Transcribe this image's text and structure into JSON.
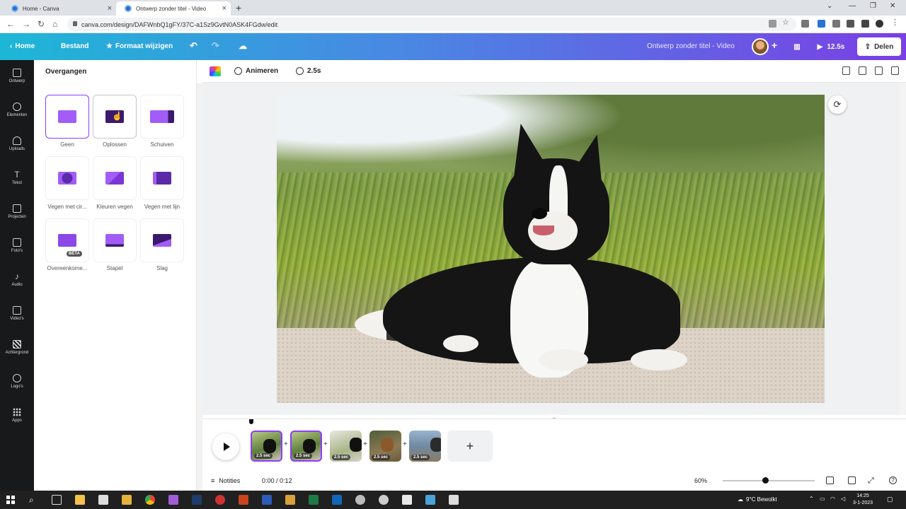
{
  "browser": {
    "tabs": [
      {
        "title": "Home - Canva",
        "active": false
      },
      {
        "title": "Ontwerp zonder titel - Video",
        "active": true
      }
    ],
    "new_tab_icon": "plus-icon",
    "url": "canva.com/design/DAFWnbQ1gFY/37C-a1Sz9GvtN0ASK4FGdw/edit"
  },
  "header": {
    "back_label": "Home",
    "file_label": "Bestand",
    "resize_label": "Formaat wijzigen",
    "doc_title": "Ontwerp zonder titel - Video",
    "play_duration": "12.5s",
    "share_label": "Delen",
    "colors": {
      "gradient_start": "#1db7d6",
      "gradient_end": "#7a3fe4",
      "accent": "#8b3dff"
    }
  },
  "rail": {
    "items": [
      {
        "label": "Ontwerp",
        "icon": "layout-icon"
      },
      {
        "label": "Elementen",
        "icon": "shapes-icon"
      },
      {
        "label": "Uploads",
        "icon": "cloud-upload-icon"
      },
      {
        "label": "Tekst",
        "icon": "text-icon"
      },
      {
        "label": "Projecten",
        "icon": "folder-icon"
      },
      {
        "label": "Foto's",
        "icon": "image-icon"
      },
      {
        "label": "Audio",
        "icon": "music-icon"
      },
      {
        "label": "Video's",
        "icon": "video-icon"
      },
      {
        "label": "Achtergrond",
        "icon": "pattern-icon"
      },
      {
        "label": "Logo's",
        "icon": "logo-icon"
      },
      {
        "label": "Apps",
        "icon": "apps-grid-icon"
      }
    ]
  },
  "panel": {
    "title": "Overgangen",
    "transitions": [
      {
        "label": "Geen",
        "state": "selected"
      },
      {
        "label": "Oplossen",
        "state": "hover"
      },
      {
        "label": "Schuiven",
        "state": "normal"
      },
      {
        "label": "Vegen met cir...",
        "state": "normal"
      },
      {
        "label": "Kleuren vegen",
        "state": "normal"
      },
      {
        "label": "Vegen met lijn",
        "state": "normal"
      },
      {
        "label": "Overeenkome...",
        "state": "normal",
        "badge": "BÈTA"
      },
      {
        "label": "Stapel",
        "state": "normal"
      },
      {
        "label": "Slag",
        "state": "normal"
      }
    ]
  },
  "toolbar": {
    "animate_label": "Animeren",
    "duration_label": "2.5s"
  },
  "timeline": {
    "clips": [
      {
        "label": "2.5 sec",
        "selected": true
      },
      {
        "label": "2.5 sec",
        "selected": true
      },
      {
        "label": "2.5 sec",
        "selected": false
      },
      {
        "label": "2.5 sec",
        "selected": false
      },
      {
        "label": "2.5 sec",
        "selected": false
      }
    ],
    "add_clip_icon": "plus-icon"
  },
  "footer": {
    "notes_label": "Notities",
    "time": "0:00 / 0:12",
    "zoom": "60%",
    "zoom_level": 0.6
  },
  "taskbar": {
    "weather": "9°C  Bewolkt",
    "time": "14:25",
    "date": "3-1-2023"
  }
}
